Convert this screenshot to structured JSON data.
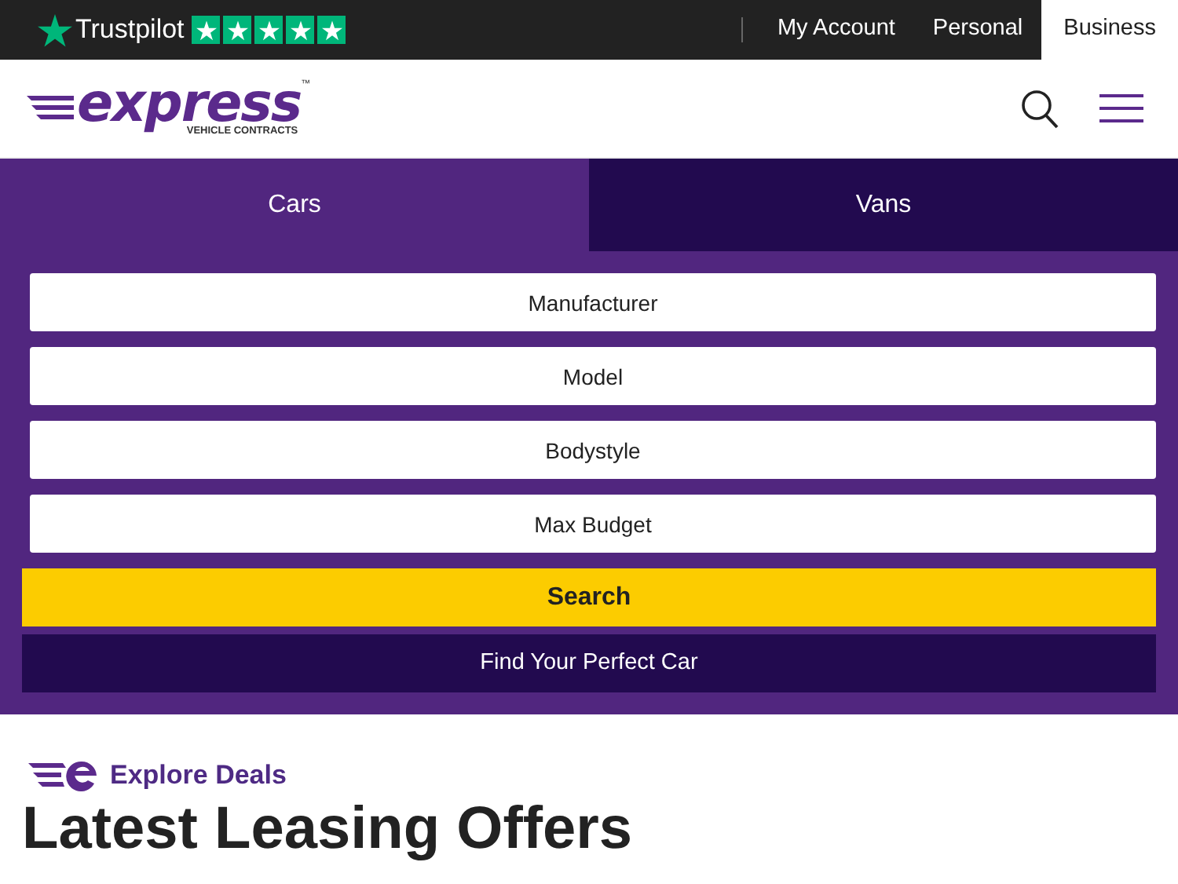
{
  "top_bar": {
    "brand": "Trustpilot",
    "stars": 5,
    "links": [
      {
        "label": "My Account",
        "selected": false
      },
      {
        "label": "Personal",
        "selected": false
      },
      {
        "label": "Business",
        "selected": true
      }
    ]
  },
  "header": {
    "logo": {
      "wordmark": "express",
      "trademark": "™",
      "tagline": "VEHICLE CONTRACTS"
    }
  },
  "tabs": [
    {
      "label": "Cars",
      "selected": true
    },
    {
      "label": "Vans",
      "selected": false
    }
  ],
  "search_form": {
    "fields": [
      {
        "placeholder": "Manufacturer"
      },
      {
        "placeholder": "Model"
      },
      {
        "placeholder": "Bodystyle"
      },
      {
        "placeholder": "Max Budget"
      }
    ],
    "search_button": "Search",
    "finder_button": "Find Your Perfect Car"
  },
  "section": {
    "eyebrow": "Explore Deals",
    "heading": "Latest Leasing Offers"
  }
}
